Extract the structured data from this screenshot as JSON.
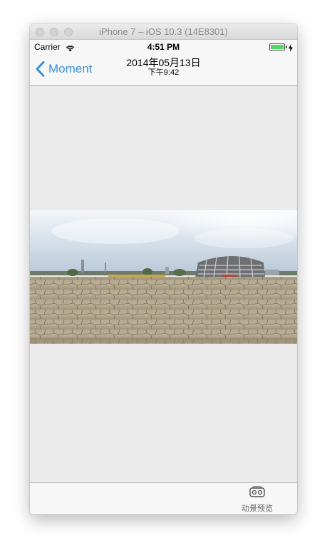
{
  "window": {
    "title": "iPhone 7 – iOS 10.3 (14E8301)"
  },
  "status_bar": {
    "carrier": "Carrier",
    "time": "4:51 PM",
    "battery_level": 1.0,
    "battery_color": "#4cd964"
  },
  "nav_bar": {
    "back_label": "Moment",
    "title_date": "2014年05月13日",
    "title_time": "下午9:42",
    "accent_color": "#3a8fd9"
  },
  "content": {
    "image_subject": "panorama-stadium-plaza"
  },
  "toolbar": {
    "vr_preview_label": "动景预览",
    "vr_icon": "vr-headset-icon"
  }
}
